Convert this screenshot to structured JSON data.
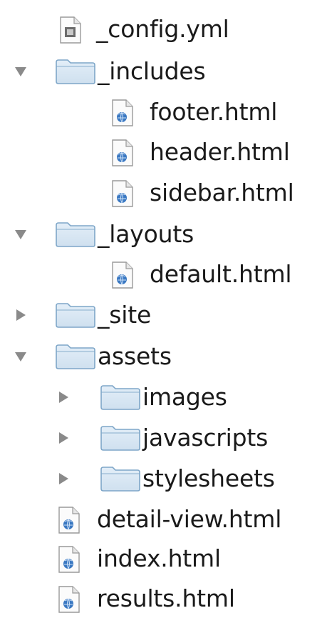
{
  "file_tree": {
    "items": [
      {
        "id": "config",
        "label": "_config.yml",
        "type": "config",
        "depth": 1,
        "state": "none"
      },
      {
        "id": "includes",
        "label": "_includes",
        "type": "folder",
        "depth": 1,
        "state": "expanded"
      },
      {
        "id": "footer",
        "label": "footer.html",
        "type": "html",
        "depth": 2,
        "state": "none"
      },
      {
        "id": "header",
        "label": "header.html",
        "type": "html",
        "depth": 2,
        "state": "none"
      },
      {
        "id": "sidebar",
        "label": "sidebar.html",
        "type": "html",
        "depth": 2,
        "state": "none"
      },
      {
        "id": "layouts",
        "label": "_layouts",
        "type": "folder",
        "depth": 1,
        "state": "expanded"
      },
      {
        "id": "default",
        "label": "default.html",
        "type": "html",
        "depth": 2,
        "state": "none"
      },
      {
        "id": "site",
        "label": "_site",
        "type": "folder",
        "depth": 1,
        "state": "collapsed"
      },
      {
        "id": "assets",
        "label": "assets",
        "type": "folder",
        "depth": 1,
        "state": "expanded"
      },
      {
        "id": "images",
        "label": "images",
        "type": "folder",
        "depth": 2,
        "state": "collapsed"
      },
      {
        "id": "javascripts",
        "label": "javascripts",
        "type": "folder",
        "depth": 2,
        "state": "collapsed"
      },
      {
        "id": "stylesheets",
        "label": "stylesheets",
        "type": "folder",
        "depth": 2,
        "state": "collapsed"
      },
      {
        "id": "detail-view",
        "label": "detail-view.html",
        "type": "html",
        "depth": 1,
        "state": "none"
      },
      {
        "id": "index",
        "label": "index.html",
        "type": "html",
        "depth": 1,
        "state": "none"
      },
      {
        "id": "results",
        "label": "results.html",
        "type": "html",
        "depth": 1,
        "state": "none"
      }
    ]
  },
  "icons": {
    "folder": "folder-icon",
    "html": "html-file-icon",
    "config": "config-file-icon",
    "expanded": "disclosure-triangle-down-icon",
    "collapsed": "disclosure-triangle-right-icon"
  },
  "colors": {
    "text": "#1a1a1a",
    "disclosure": "#8a8a8a",
    "folder_light": "#cfe0ef",
    "folder_dark": "#7ea6c8",
    "file_accent": "#3a78c2"
  }
}
